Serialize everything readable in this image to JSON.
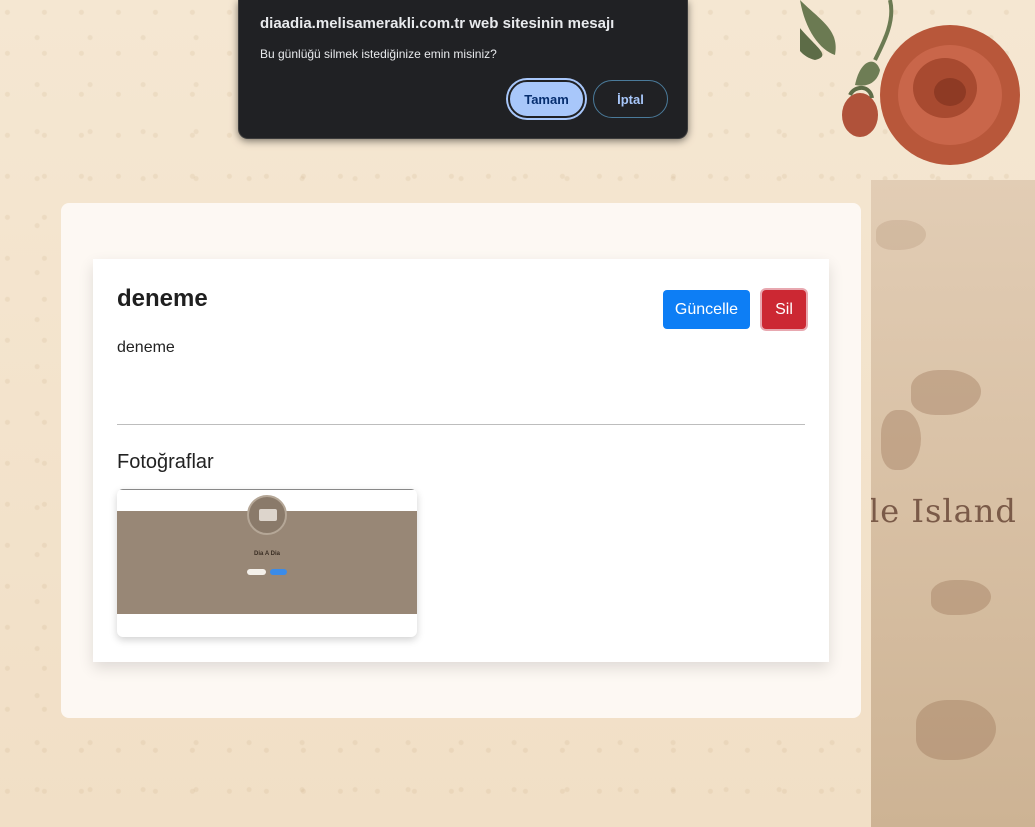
{
  "dialog": {
    "title": "diaadia.melisamerakli.com.tr web sitesinin mesajı",
    "message": "Bu günlüğü silmek istediğinize emin misiniz?",
    "ok_label": "Tamam",
    "cancel_label": "İptal"
  },
  "entry": {
    "title": "deneme",
    "body": "deneme",
    "update_label": "Güncelle",
    "delete_label": "Sil",
    "photos_heading": "Fotoğraflar",
    "photo_thumbnail": {
      "title": "Dia A Dia"
    }
  },
  "background": {
    "map_text": "le Island"
  },
  "colors": {
    "update_button": "#0d7ef5",
    "delete_button": "#cc2833",
    "dialog_background": "#202124",
    "dialog_accent": "#a8c7fa",
    "thumbnail_band": "#988776"
  }
}
